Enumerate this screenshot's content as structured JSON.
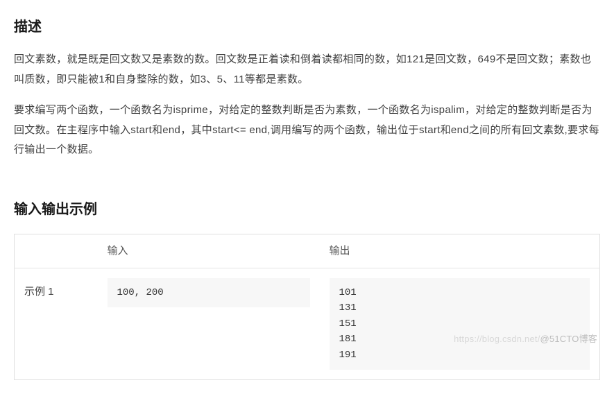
{
  "description": {
    "title": "描述",
    "para1": "回文素数，就是既是回文数又是素数的数。回文数是正着读和倒着读都相同的数，如121是回文数，649不是回文数；素数也叫质数，即只能被1和自身整除的数，如3、5、11等都是素数。",
    "para2": "要求编写两个函数，一个函数名为isprime，对给定的整数判断是否为素数，一个函数名为ispalim，对给定的整数判断是否为回文数。在主程序中输入start和end，其中start<= end,调用编写的两个函数，输出位于start和end之间的所有回文素数,要求每行输出一个数据。"
  },
  "io": {
    "title": "输入输出示例",
    "headers": {
      "blank": "",
      "input": "输入",
      "output": "输出"
    },
    "example": {
      "label": "示例 1",
      "input": "100, 200",
      "output": "101\n131\n151\n181\n191"
    }
  },
  "watermark": {
    "left": "https://blog.csdn.net/",
    "right": "@51CTO博客"
  }
}
